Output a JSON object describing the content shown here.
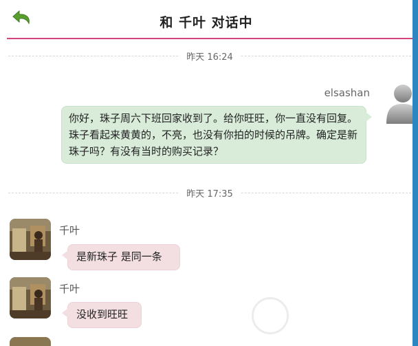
{
  "header": {
    "title": "和 千叶 对话中",
    "back_icon": "back-arrow-icon",
    "accent_color": "#d3437d"
  },
  "dividers": [
    {
      "time": "昨天 16:24"
    },
    {
      "time": "昨天 17:35"
    }
  ],
  "outgoing": {
    "username": "elsashan",
    "avatar_icon": "default-user-icon",
    "bubble_color": "#d8ecd9",
    "message": "你好，珠子周六下班回家收到了。给你旺旺，你一直没有回复。珠子看起来黄黄的，不亮，也没有你拍的时候的吊牌。确定是新珠子吗？有没有当时的购买记录？"
  },
  "incoming": {
    "name": "千叶",
    "bubble_color": "#f3dfe2",
    "messages": [
      {
        "text": "是新珠子 是同一条"
      },
      {
        "text": "没收到旺旺"
      }
    ]
  }
}
